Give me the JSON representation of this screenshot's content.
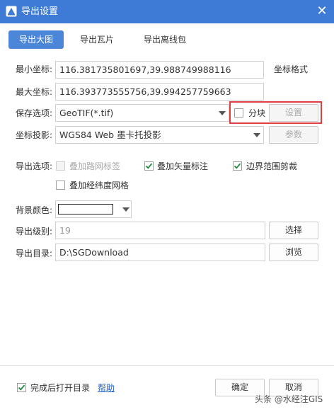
{
  "window": {
    "title": "导出设置",
    "close_glyph": "✕",
    "accent": "#3d7bd6"
  },
  "tabs": [
    {
      "label": "导出大图",
      "active": true
    },
    {
      "label": "导出瓦片",
      "active": false
    },
    {
      "label": "导出离线包",
      "active": false
    }
  ],
  "min_coord": {
    "label": "最小坐标:",
    "value": "116.381735801697,39.988749988116"
  },
  "coord_format_label": "坐标格式",
  "max_coord": {
    "label": "最大坐标:",
    "value": "116.393773555756,39.994257759663"
  },
  "save_option": {
    "label": "保存选项:",
    "value": "GeoTIF(*.tif)"
  },
  "tiling": {
    "label": "分块",
    "checked": false
  },
  "settings_button": "设置",
  "projection": {
    "label": "坐标投影:",
    "value": "WGS84 Web 墨卡托投影"
  },
  "params_button": "参数",
  "export_options": {
    "label": "导出选项:",
    "overlay_road_labels": {
      "label": "叠加路网标签",
      "checked": false,
      "disabled": true
    },
    "overlay_vector_labels": {
      "label": "叠加矢量标注",
      "checked": true
    },
    "boundary_clip": {
      "label": "边界范围剪裁",
      "checked": true
    },
    "overlay_graticule": {
      "label": "叠加经纬度网格",
      "checked": false
    }
  },
  "background_color": {
    "label": "背景颜色:",
    "value": "#ffffff"
  },
  "export_level": {
    "label": "导出级别:",
    "value": "19"
  },
  "select_button": "选择",
  "export_dir": {
    "label": "导出目录:",
    "value": "D:\\SGDownload"
  },
  "browse_button": "浏览",
  "footer": {
    "open_dir_after": {
      "label": "完成后打开目录",
      "checked": true
    },
    "help_link": "帮助",
    "ok_button": "确定",
    "cancel_button": "取消"
  },
  "watermark": "头条 @水经注GIS"
}
